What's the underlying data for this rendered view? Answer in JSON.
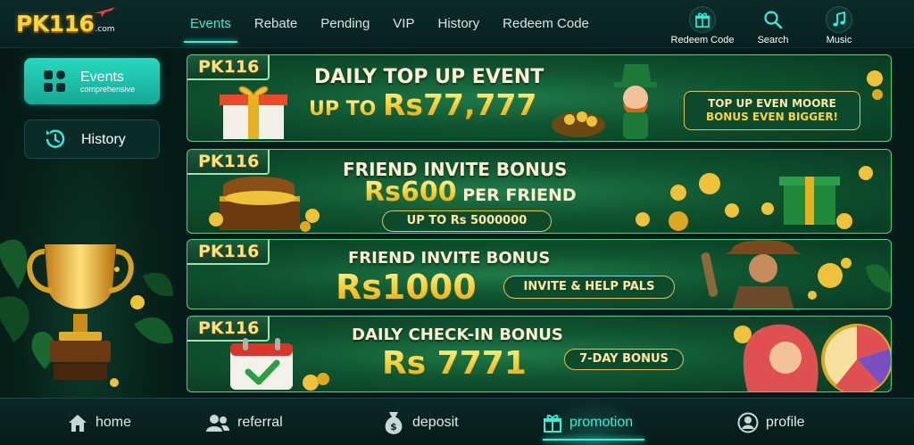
{
  "app": {
    "logo": "PK116",
    "logo_suffix": ".com"
  },
  "nav": {
    "items": [
      {
        "label": "Events",
        "active": true
      },
      {
        "label": "Rebate"
      },
      {
        "label": "Pending"
      },
      {
        "label": "VIP"
      },
      {
        "label": "History"
      },
      {
        "label": "Redeem Code"
      }
    ]
  },
  "header_buttons": {
    "redeem": {
      "label": "Redeem Code",
      "icon": "gift-icon"
    },
    "search": {
      "label": "Search",
      "icon": "search-icon"
    },
    "music": {
      "label": "Music",
      "icon": "music-icon"
    }
  },
  "sidebar": {
    "events": {
      "title": "Events",
      "subtitle": "comprehensive",
      "icon": "grid-icon"
    },
    "history": {
      "title": "History",
      "icon": "history-icon"
    }
  },
  "banners": [
    {
      "tag": "PK116",
      "headline": "DAILY TOP UP EVENT",
      "line2a": "UP TO ",
      "line2b": "Rs77,777",
      "callout1": "TOP UP EVEN MOORE",
      "callout2": "BONUS EVEN BIGGER!"
    },
    {
      "tag": "PK116",
      "headline": "FRIEND INVITE BONUS",
      "amount": "Rs600",
      "amount_suffix": " PER FRIEND",
      "pill": "UP TO Rs 5000000"
    },
    {
      "tag": "PK116",
      "headline": "FRIEND INVITE BONUS",
      "amount": "Rs1000",
      "pill": "INVITE & HELP PALS"
    },
    {
      "tag": "PK116",
      "headline": "DAILY CHECK-IN BONUS",
      "amount": "Rs 7771",
      "pill": "7-DAY BONUS"
    }
  ],
  "bottom_nav": {
    "home": {
      "label": "home",
      "icon": "home-icon"
    },
    "referral": {
      "label": "referral",
      "icon": "users-icon"
    },
    "deposit": {
      "label": "deposit",
      "icon": "money-bag-icon"
    },
    "promotion": {
      "label": "promotion",
      "icon": "gift-icon",
      "active": true
    },
    "profile": {
      "label": "profile",
      "icon": "user-icon"
    }
  },
  "colors": {
    "accent": "#35f0d6",
    "gold": "#ffd43a",
    "banner_green": "#0f5430",
    "background": "#061a19"
  }
}
